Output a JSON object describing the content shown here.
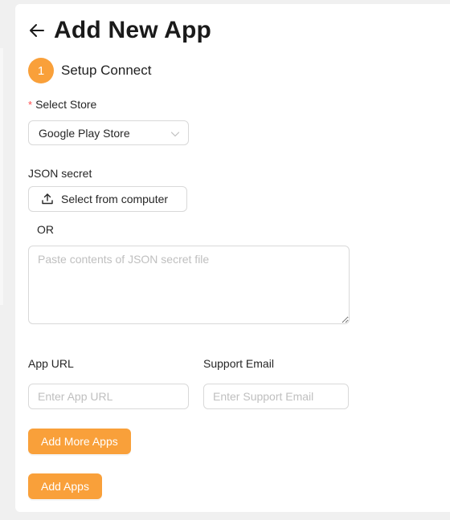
{
  "header": {
    "title": "Add New App",
    "back_icon": "arrow-left-icon"
  },
  "step": {
    "number": "1",
    "label": "Setup Connect"
  },
  "store": {
    "required_mark": "*",
    "label": "Select Store",
    "selected": "Google Play Store",
    "chevron_icon": "chevron-down-icon"
  },
  "json_secret": {
    "label": "JSON secret",
    "upload_label": "Select from computer",
    "upload_icon": "upload-icon",
    "or_text": "OR",
    "placeholder": "Paste contents of JSON secret file",
    "value": ""
  },
  "app_url": {
    "label": "App URL",
    "placeholder": "Enter App URL",
    "value": ""
  },
  "support_email": {
    "label": "Support Email",
    "placeholder": "Enter Support Email",
    "value": ""
  },
  "buttons": {
    "add_more": "Add More Apps",
    "add": "Add Apps"
  },
  "colors": {
    "accent": "#f9a03a",
    "required": "#ff4d4f",
    "border": "#d9d9d9",
    "placeholder": "#bfbfbf"
  }
}
